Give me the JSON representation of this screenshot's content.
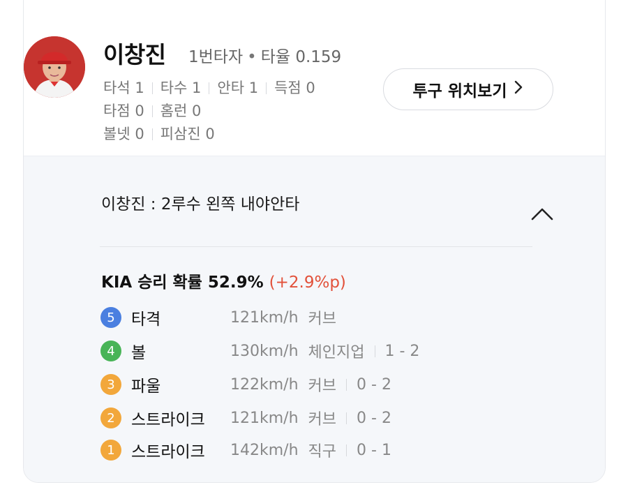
{
  "player": {
    "name": "이창진",
    "order": "1번타자",
    "avg_label": "타율 0.159"
  },
  "stats": {
    "row1": [
      "타석 1",
      "타수 1",
      "안타 1",
      "득점 0"
    ],
    "row2": [
      "타점 0",
      "홈런 0"
    ],
    "row3": [
      "볼넷 0",
      "피삼진 0"
    ]
  },
  "buttons": {
    "pitch_location": "투구 위치보기",
    "pitch_location_icon": "chevron-right-icon",
    "collapse_icon": "chevron-up-icon"
  },
  "play": {
    "title": "이창진 : 2루수 왼쪽 내야안타",
    "win_prob": "KIA 승리 확률 52.9%",
    "win_prob_delta": "(+2.9%p)"
  },
  "colors": {
    "blue": "#4a7fe0",
    "green": "#48b457",
    "orange": "#f2a73b",
    "delta_red": "#e2513a"
  },
  "pitches": [
    {
      "num": "5",
      "result": "타격",
      "speed": "121km/h",
      "type": "커브",
      "count": "",
      "color": "#4a7fe0"
    },
    {
      "num": "4",
      "result": "볼",
      "speed": "130km/h",
      "type": "체인지업",
      "count": "1 - 2",
      "color": "#48b457"
    },
    {
      "num": "3",
      "result": "파울",
      "speed": "122km/h",
      "type": "커브",
      "count": "0 - 2",
      "color": "#f2a73b"
    },
    {
      "num": "2",
      "result": "스트라이크",
      "speed": "121km/h",
      "type": "커브",
      "count": "0 - 2",
      "color": "#f2a73b"
    },
    {
      "num": "1",
      "result": "스트라이크",
      "speed": "142km/h",
      "type": "직구",
      "count": "0 - 1",
      "color": "#f2a73b"
    }
  ]
}
